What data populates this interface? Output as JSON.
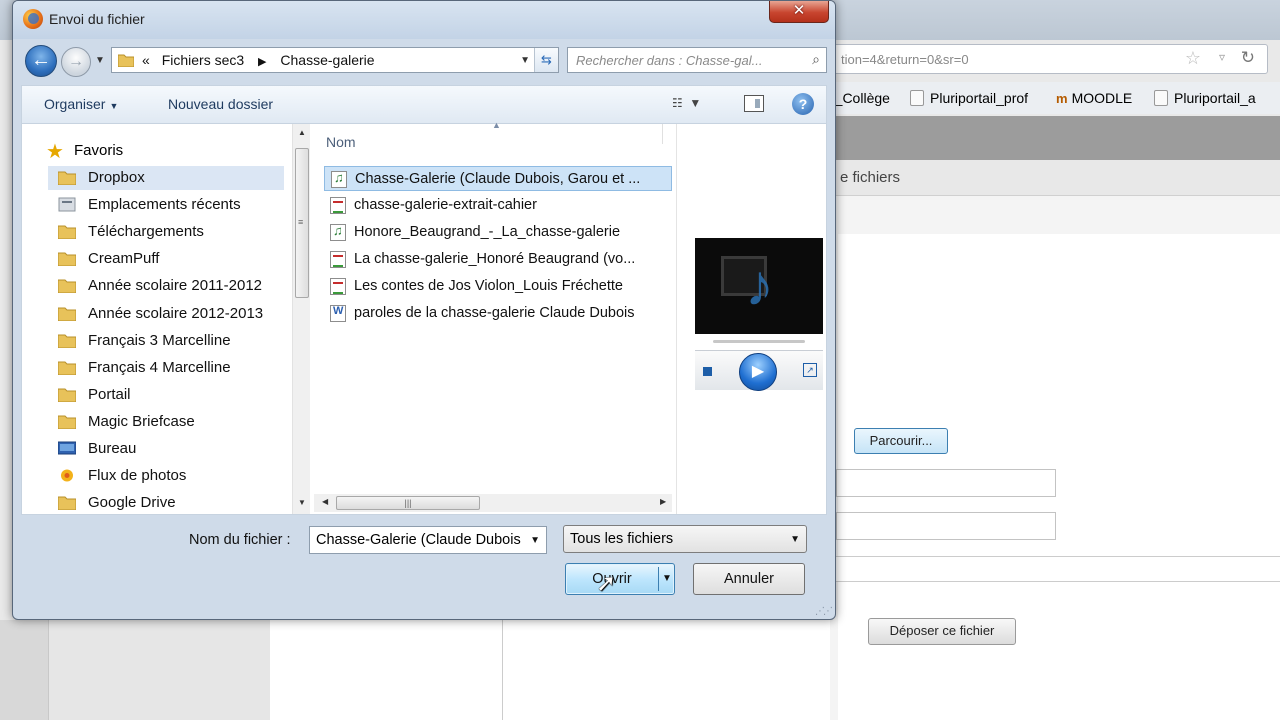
{
  "background": {
    "url_text": "tion=4&return=0&sr=0",
    "bookmarks": [
      "r_Collège",
      "Pluriportail_prof",
      "MOODLE",
      "Pluriportail_a"
    ],
    "section_title": "e fichiers",
    "browse_button": "Parcourir...",
    "upload_button": "Déposer ce fichier"
  },
  "dialog": {
    "title": "Envoi du fichier",
    "close_label": "✕",
    "breadcrumb": [
      "Fichiers sec3",
      "Chasse-galerie"
    ],
    "breadcrumb_overflow": "«",
    "search_placeholder": "Rechercher dans : Chasse-gal...",
    "toolbar": {
      "organize": "Organiser",
      "new_folder": "Nouveau dossier",
      "help": "?"
    },
    "nav": {
      "favorites": "Favoris",
      "items": [
        {
          "label": "Dropbox",
          "icon": "folder-icon",
          "selected": true
        },
        {
          "label": "Emplacements récents",
          "icon": "recent-places-icon",
          "selected": false
        },
        {
          "label": "Téléchargements",
          "icon": "downloads-folder-icon",
          "selected": false
        },
        {
          "label": "CreamPuff",
          "icon": "folder-icon",
          "selected": false
        },
        {
          "label": "Année scolaire 2011-2012",
          "icon": "folder-icon",
          "selected": false
        },
        {
          "label": "Année scolaire 2012-2013",
          "icon": "folder-icon",
          "selected": false
        },
        {
          "label": "Français 3 Marcelline",
          "icon": "folder-icon",
          "selected": false
        },
        {
          "label": "Français 4 Marcelline",
          "icon": "folder-icon",
          "selected": false
        },
        {
          "label": "Portail",
          "icon": "folder-icon",
          "selected": false
        },
        {
          "label": "Magic Briefcase",
          "icon": "folder-icon",
          "selected": false
        },
        {
          "label": "Bureau",
          "icon": "desktop-icon",
          "selected": false
        },
        {
          "label": "Flux de photos",
          "icon": "photo-stream-icon",
          "selected": false
        },
        {
          "label": "Google Drive",
          "icon": "google-drive-folder-icon",
          "selected": false
        }
      ]
    },
    "files": {
      "column_name": "Nom",
      "items": [
        {
          "label": "Chasse-Galerie (Claude Dubois, Garou et ...",
          "type": "audio",
          "selected": true
        },
        {
          "label": "chasse-galerie-extrait-cahier",
          "type": "pdf",
          "selected": false
        },
        {
          "label": "Honore_Beaugrand_-_La_chasse-galerie",
          "type": "audio",
          "selected": false
        },
        {
          "label": "La chasse-galerie_Honoré Beaugrand (vo...",
          "type": "pdf",
          "selected": false
        },
        {
          "label": "Les contes de Jos Violon_Louis Fréchette",
          "type": "pdf",
          "selected": false
        },
        {
          "label": "paroles de la chasse-galerie Claude Dubois",
          "type": "doc",
          "selected": false
        }
      ]
    },
    "bottom": {
      "filename_label": "Nom du fichier :",
      "filename_value": "Chasse-Galerie (Claude Dubois",
      "filter_value": "Tous les fichiers",
      "open_button": "Ouvrir",
      "cancel_button": "Annuler"
    }
  },
  "colors": {
    "selection": "#cde3f7",
    "nav_selection": "#dbe6f4",
    "dialog_frame": "#cfdbe9",
    "accent_blue": "#2e6fbd"
  }
}
